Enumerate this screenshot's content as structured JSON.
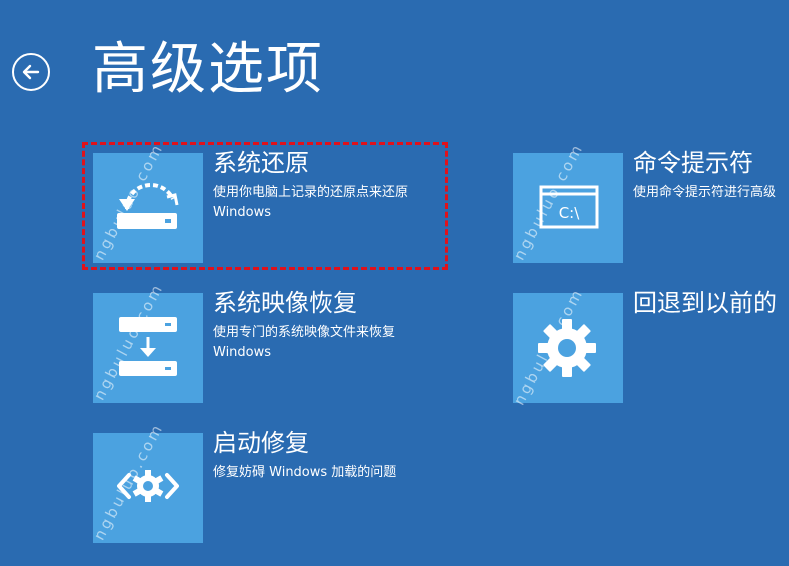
{
  "header": {
    "title": "高级选项"
  },
  "options": [
    {
      "title": "系统还原",
      "description": "使用你电脑上记录的还原点来还原 Windows",
      "icon": "system-restore-icon"
    },
    {
      "title": "命令提示符",
      "description": "使用命令提示符进行高级",
      "icon": "command-prompt-icon",
      "icon_text": "C:\\"
    },
    {
      "title": "系统映像恢复",
      "description": "使用专门的系统映像文件来恢复 Windows",
      "icon": "system-image-recovery-icon"
    },
    {
      "title": "回退到以前的",
      "description": "",
      "icon": "gear-icon"
    },
    {
      "title": "启动修复",
      "description": "修复妨碍 Windows 加载的问题",
      "icon": "startup-repair-icon"
    }
  ],
  "watermark": {
    "text": "ngbuluo.com"
  },
  "colors": {
    "background": "#2a6bb1",
    "tile": "#4ba2e0",
    "highlight": "#e0121b",
    "text": "#ffffff"
  }
}
